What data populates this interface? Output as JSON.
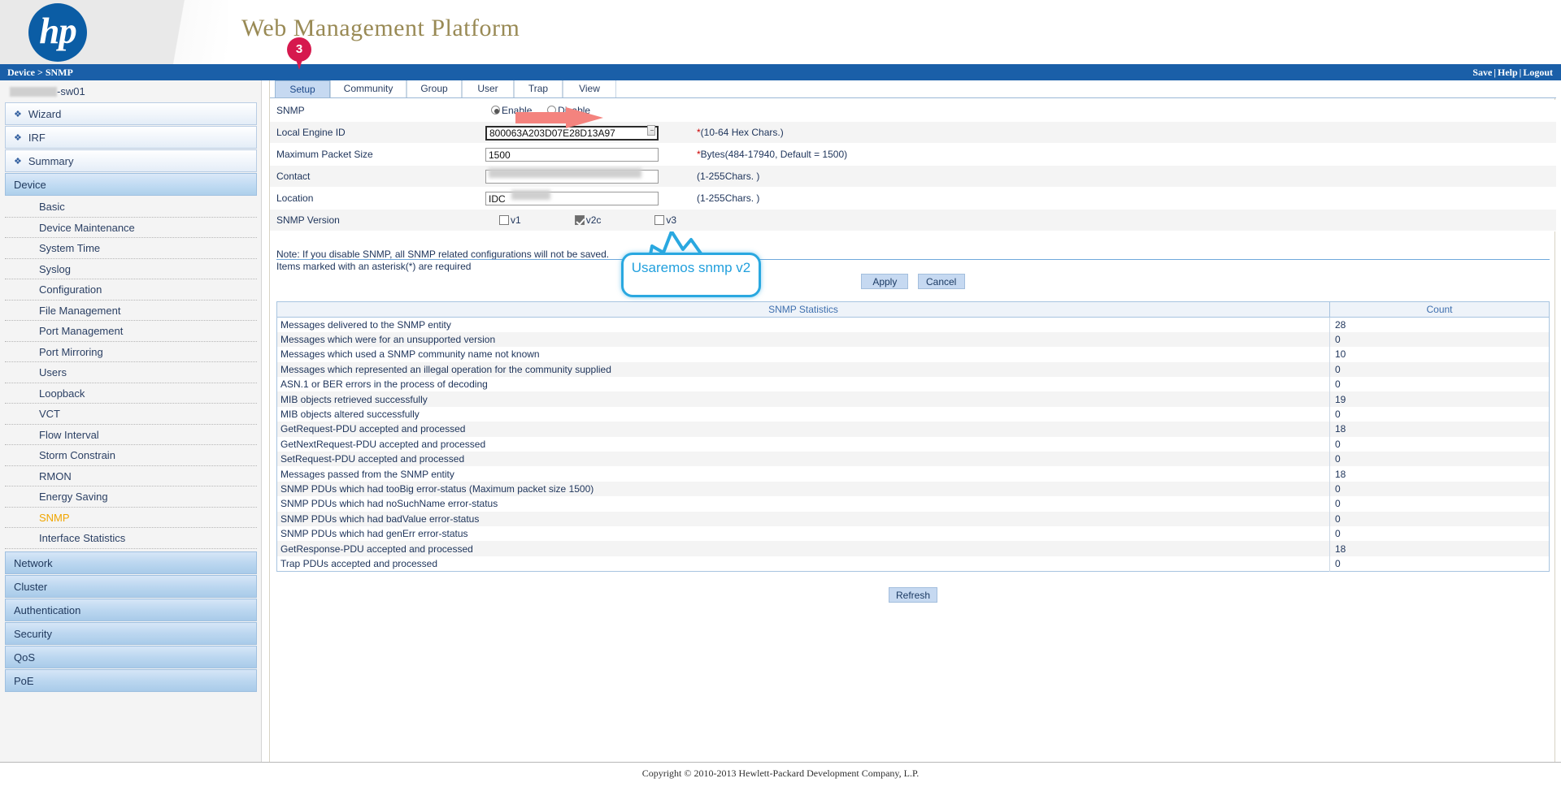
{
  "header": {
    "logo_alt": "hp",
    "platform_title": "Web Management Platform",
    "breadcrumb": "Device > SNMP",
    "links": {
      "save": "Save",
      "help": "Help",
      "logout": "Logout",
      "separator": "|"
    }
  },
  "sidebar": {
    "device_name_suffix": "-sw01",
    "top_items": [
      {
        "label": "Wizard"
      },
      {
        "label": "IRF"
      },
      {
        "label": "Summary"
      }
    ],
    "sections": [
      {
        "label": "Device",
        "active": true
      }
    ],
    "device_children": [
      {
        "label": "Basic"
      },
      {
        "label": "Device Maintenance"
      },
      {
        "label": "System Time"
      },
      {
        "label": "Syslog"
      },
      {
        "label": "Configuration"
      },
      {
        "label": "File Management"
      },
      {
        "label": "Port Management"
      },
      {
        "label": "Port Mirroring"
      },
      {
        "label": "Users"
      },
      {
        "label": "Loopback"
      },
      {
        "label": "VCT"
      },
      {
        "label": "Flow Interval"
      },
      {
        "label": "Storm Constrain"
      },
      {
        "label": "RMON"
      },
      {
        "label": "Energy Saving"
      },
      {
        "label": "SNMP",
        "selected": true
      },
      {
        "label": "Interface Statistics"
      }
    ],
    "bottom_sections": [
      {
        "label": "Network"
      },
      {
        "label": "Cluster"
      },
      {
        "label": "Authentication"
      },
      {
        "label": "Security"
      },
      {
        "label": "QoS"
      },
      {
        "label": "PoE"
      }
    ]
  },
  "tabs": [
    {
      "label": "Setup",
      "active": true
    },
    {
      "label": "Community",
      "active": false
    },
    {
      "label": "Group",
      "active": false
    },
    {
      "label": "User",
      "active": false
    },
    {
      "label": "Trap",
      "active": false
    },
    {
      "label": "View",
      "active": false
    }
  ],
  "form": {
    "snmp": {
      "label": "SNMP",
      "enable_label": "Enable",
      "disable_label": "Disable",
      "selected": "Enable"
    },
    "local_engine_id": {
      "label": "Local Engine ID",
      "value": "800063A203D07E28D13A97",
      "hint_star": "*",
      "hint": "(10-64 Hex Chars.)"
    },
    "max_packet_size": {
      "label": "Maximum Packet Size",
      "value": "1500",
      "hint_star": "*",
      "hint": "Bytes(484-17940, Default = 1500)"
    },
    "contact": {
      "label": "Contact",
      "value": "",
      "hint": "(1-255Chars. )",
      "redacted": true
    },
    "location": {
      "label": "Location",
      "value": "IDC",
      "hint": "(1-255Chars. )",
      "redacted": true
    },
    "snmp_version": {
      "label": "SNMP Version",
      "options": [
        {
          "label": "v1",
          "checked": false
        },
        {
          "label": "v2c",
          "checked": true
        },
        {
          "label": "v3",
          "checked": false
        }
      ]
    },
    "note_line1": "Note: If you disable SNMP, all SNMP related configurations will not be saved.",
    "note_line2": "Items marked with an asterisk(*) are required",
    "apply_label": "Apply",
    "cancel_label": "Cancel"
  },
  "statistics": {
    "header_title": "SNMP Statistics",
    "header_count": "Count",
    "rows": [
      {
        "name": "Messages delivered to the SNMP entity",
        "count": "28"
      },
      {
        "name": "Messages which were for an unsupported version",
        "count": "0"
      },
      {
        "name": "Messages which used a SNMP community name not known",
        "count": "10"
      },
      {
        "name": "Messages which represented an illegal operation for the community supplied",
        "count": "0"
      },
      {
        "name": "ASN.1 or BER errors in the process of decoding",
        "count": "0"
      },
      {
        "name": "MIB objects retrieved successfully",
        "count": "19"
      },
      {
        "name": "MIB objects altered successfully",
        "count": "0"
      },
      {
        "name": "GetRequest-PDU accepted and processed",
        "count": "18"
      },
      {
        "name": "GetNextRequest-PDU accepted and processed",
        "count": "0"
      },
      {
        "name": "SetRequest-PDU accepted and processed",
        "count": "0"
      },
      {
        "name": "Messages passed from the SNMP entity",
        "count": "18"
      },
      {
        "name": "SNMP PDUs which had tooBig error-status (Maximum packet size 1500)",
        "count": "0"
      },
      {
        "name": "SNMP PDUs which had noSuchName error-status",
        "count": "0"
      },
      {
        "name": "SNMP PDUs which had badValue error-status",
        "count": "0"
      },
      {
        "name": "SNMP PDUs which had genErr error-status",
        "count": "0"
      },
      {
        "name": "GetResponse-PDU accepted and processed",
        "count": "18"
      },
      {
        "name": "Trap PDUs accepted and processed",
        "count": "0"
      }
    ],
    "refresh_label": "Refresh"
  },
  "annotations": {
    "step_pin": "3",
    "callout_text": "Usaremos snmp v2",
    "callout_color": "#22a0dd",
    "arrow_color": "#f4837e",
    "pin_color": "#d6194e"
  },
  "footer": {
    "copyright": "Copyright © 2010-2013 Hewlett-Packard Development Company, L.P."
  }
}
